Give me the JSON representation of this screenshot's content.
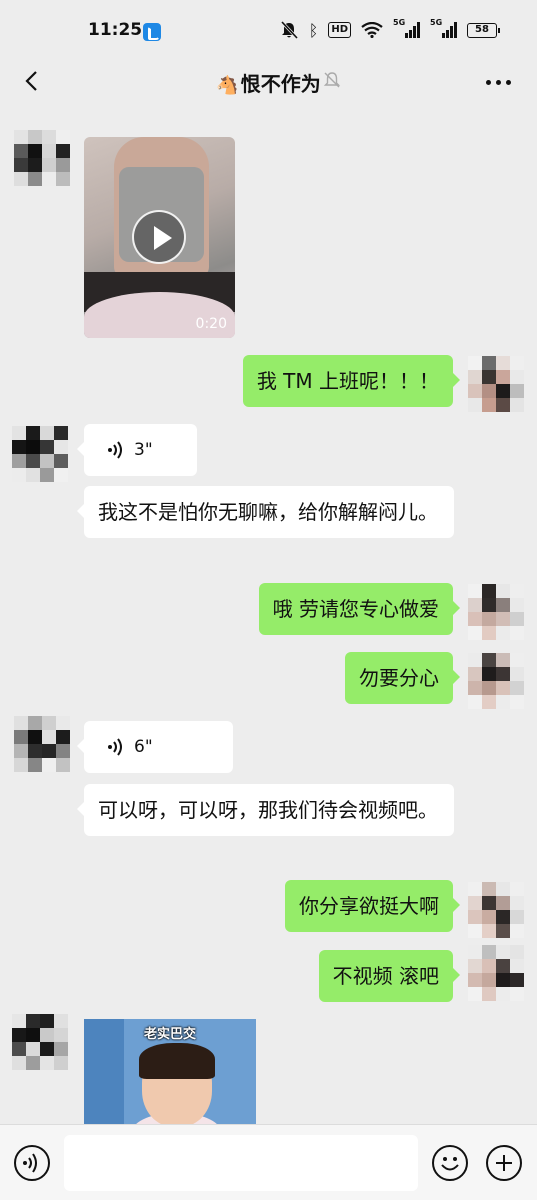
{
  "status_bar": {
    "time": "11:25",
    "signal_1_label": "5G",
    "signal_2_label": "5G",
    "hd_label": "HD",
    "battery": "58"
  },
  "nav": {
    "title_emoji": "🐴",
    "title": "恨不作为"
  },
  "messages": {
    "video": {
      "duration": "0:20"
    },
    "out_1": "我 TM 上班呢！！！",
    "voice_1": "3\"",
    "in_1": "我这不是怕你无聊嘛，给你解解闷儿。",
    "out_2": "哦  劳请您专心做爱",
    "out_3": "勿要分心",
    "voice_2": "6\"",
    "in_2": "可以呀，可以呀，那我们待会视频吧。",
    "out_4": "你分享欲挺大啊",
    "out_5": "不视频  滚吧",
    "sticker_caption": "老实巴交"
  },
  "input": {
    "placeholder": ""
  },
  "colors": {
    "out_bubble": "#95ec69",
    "background": "#ededed",
    "in_bubble": "#ffffff"
  }
}
